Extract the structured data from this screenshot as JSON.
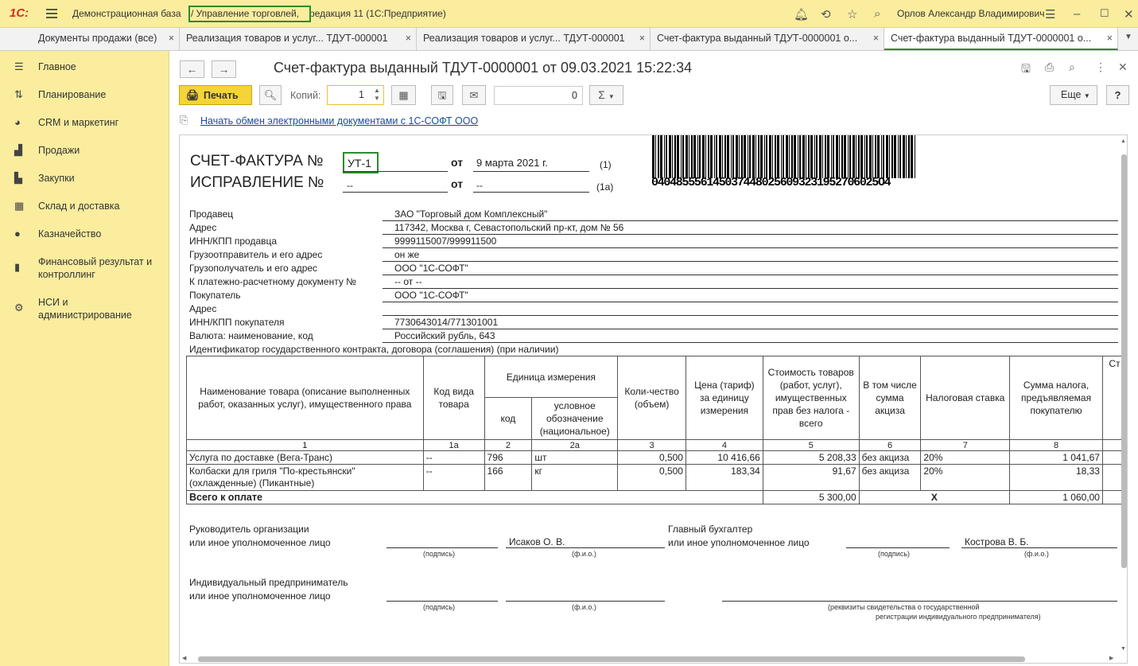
{
  "app": {
    "logo": "1С:",
    "title_left": "Демонстрационная база",
    "title_hl": "/ Управление торговлей,",
    "title_right": "редакция 11  (1С:Предприятие)",
    "user": "Орлов Александр Владимирович"
  },
  "tabs": [
    {
      "label": "Документы продажи (все)",
      "close": "×"
    },
    {
      "label": "Реализация товаров и услуг... ТДУТ-000001",
      "close": "×"
    },
    {
      "label": "Реализация товаров и услуг... ТДУТ-000001",
      "close": "×"
    },
    {
      "label": "Счет-фактура выданный ТДУТ-0000001 о...",
      "close": "×"
    },
    {
      "label": "Счет-фактура выданный ТДУТ-0000001 о...",
      "close": "×"
    }
  ],
  "sidebar": [
    {
      "label": "Главное",
      "icon": "menu-icon"
    },
    {
      "label": "Планирование",
      "icon": "planning-icon"
    },
    {
      "label": "CRM и маркетинг",
      "icon": "pie-chart-icon"
    },
    {
      "label": "Продажи",
      "icon": "bag-icon"
    },
    {
      "label": "Закупки",
      "icon": "cart-icon"
    },
    {
      "label": "Склад и доставка",
      "icon": "warehouse-icon"
    },
    {
      "label": "Казначейство",
      "icon": "coin-icon"
    },
    {
      "label": "Финансовый результат и контроллинг",
      "icon": "bar-chart-icon"
    },
    {
      "label": "НСИ и администрирование",
      "icon": "gear-icon"
    }
  ],
  "doc_title": "Счет-фактура выданный ТДУТ-0000001 от 09.03.2021 15:22:34",
  "toolbar": {
    "print": "Печать",
    "copies_label": "Копий:",
    "copies": "1",
    "number": "0",
    "sum": "Σ",
    "more": "Еще",
    "help": "?"
  },
  "edo_link": "Начать обмен электронными документами с 1С-СОФТ ООО",
  "invoice": {
    "title1": "СЧЕТ-ФАКТУРА  №",
    "num": "УТ-1",
    "ot": "от",
    "date": "9 марта 2021 г.",
    "n1": "(1)",
    "title2": "ИСПРАВЛЕНИЕ  №",
    "corr_num": "--",
    "ot2": "от",
    "corr_date": "--",
    "n1a": "(1а)",
    "barcode_num": "0404855561450374480256093231952706025O4",
    "fields": [
      {
        "label": "Продавец",
        "value": "ЗАО \"Торговый дом Комплексный\""
      },
      {
        "label": "Адрес",
        "value": "117342, Москва г, Севастопольский пр-кт, дом № 56"
      },
      {
        "label": "ИНН/КПП продавца",
        "value": "9999115007/999911500"
      },
      {
        "label": "Грузоотправитель и его адрес",
        "value": "он же"
      },
      {
        "label": "Грузополучатель и его адрес",
        "value": "ООО \"1С-СОФТ\""
      },
      {
        "label": "К платежно-расчетному документу №",
        "value": "-- от --"
      },
      {
        "label": "Покупатель",
        "value": "ООО \"1С-СОФТ\""
      },
      {
        "label": "Адрес",
        "value": ""
      },
      {
        "label": "ИНН/КПП покупателя",
        "value": "7730643014/771301001"
      },
      {
        "label": "Валюта: наименование, код",
        "value": "Российский рубль, 643"
      }
    ],
    "contract_id": "Идентификатор государственного контракта, договора (соглашения) (при наличии)",
    "headers": {
      "name": "Наименование товара (описание выполненных работ, оказанных услуг), имущественного права",
      "type_code": "Код вида товара",
      "unit": "Единица измерения",
      "unit_code": "код",
      "unit_name": "условное обозначение (национальное)",
      "qty": "Коли-чество (объем)",
      "price": "Цена (тариф) за единицу измерения",
      "cost": "Стоимость товаров (работ, услуг), имущественных прав без налога - всего",
      "excise": "В том числе сумма акциза",
      "rate": "Налоговая ставка",
      "tax": "Сумма налога, предъявляемая покупателю",
      "cut": "Ст"
    },
    "colnums": [
      "1",
      "1а",
      "2",
      "2а",
      "3",
      "4",
      "5",
      "6",
      "7",
      "8"
    ],
    "rows": [
      {
        "name": "Услуга по доставке (Вега-Транс)",
        "type": "--",
        "code": "796",
        "unit": "шт",
        "qty": "0,500",
        "price": "10 416,66",
        "cost": "5 208,33",
        "excise": "без акциза",
        "rate": "20%",
        "tax": "1 041,67"
      },
      {
        "name": "Колбаски для гриля \"По-крестьянски\" (охлажденные) (Пикантные)",
        "type": "--",
        "code": "166",
        "unit": "кг",
        "qty": "0,500",
        "price": "183,34",
        "cost": "91,67",
        "excise": "без акциза",
        "rate": "20%",
        "tax": "18,33"
      }
    ],
    "total_label": "Всего к оплате",
    "total_cost": "5 300,00",
    "total_x": "X",
    "total_tax": "1 060,00",
    "sign": {
      "head": "Руководитель организации",
      "head2": "или иное уполномоченное лицо",
      "head_name": "Исаков О. В.",
      "acc": "Главный бухгалтер",
      "acc2": "или иное уполномоченное лицо",
      "acc_name": "Кострова В. Б.",
      "sig": "(подпись)",
      "fio": "(ф.и.о.)",
      "ip": "Индивидуальный предприниматель",
      "ip2": "или иное уполномоченное лицо",
      "req1": "(реквизиты свидетельства о государственной",
      "req2": "регистрации индивидуального предпринимателя)"
    }
  }
}
